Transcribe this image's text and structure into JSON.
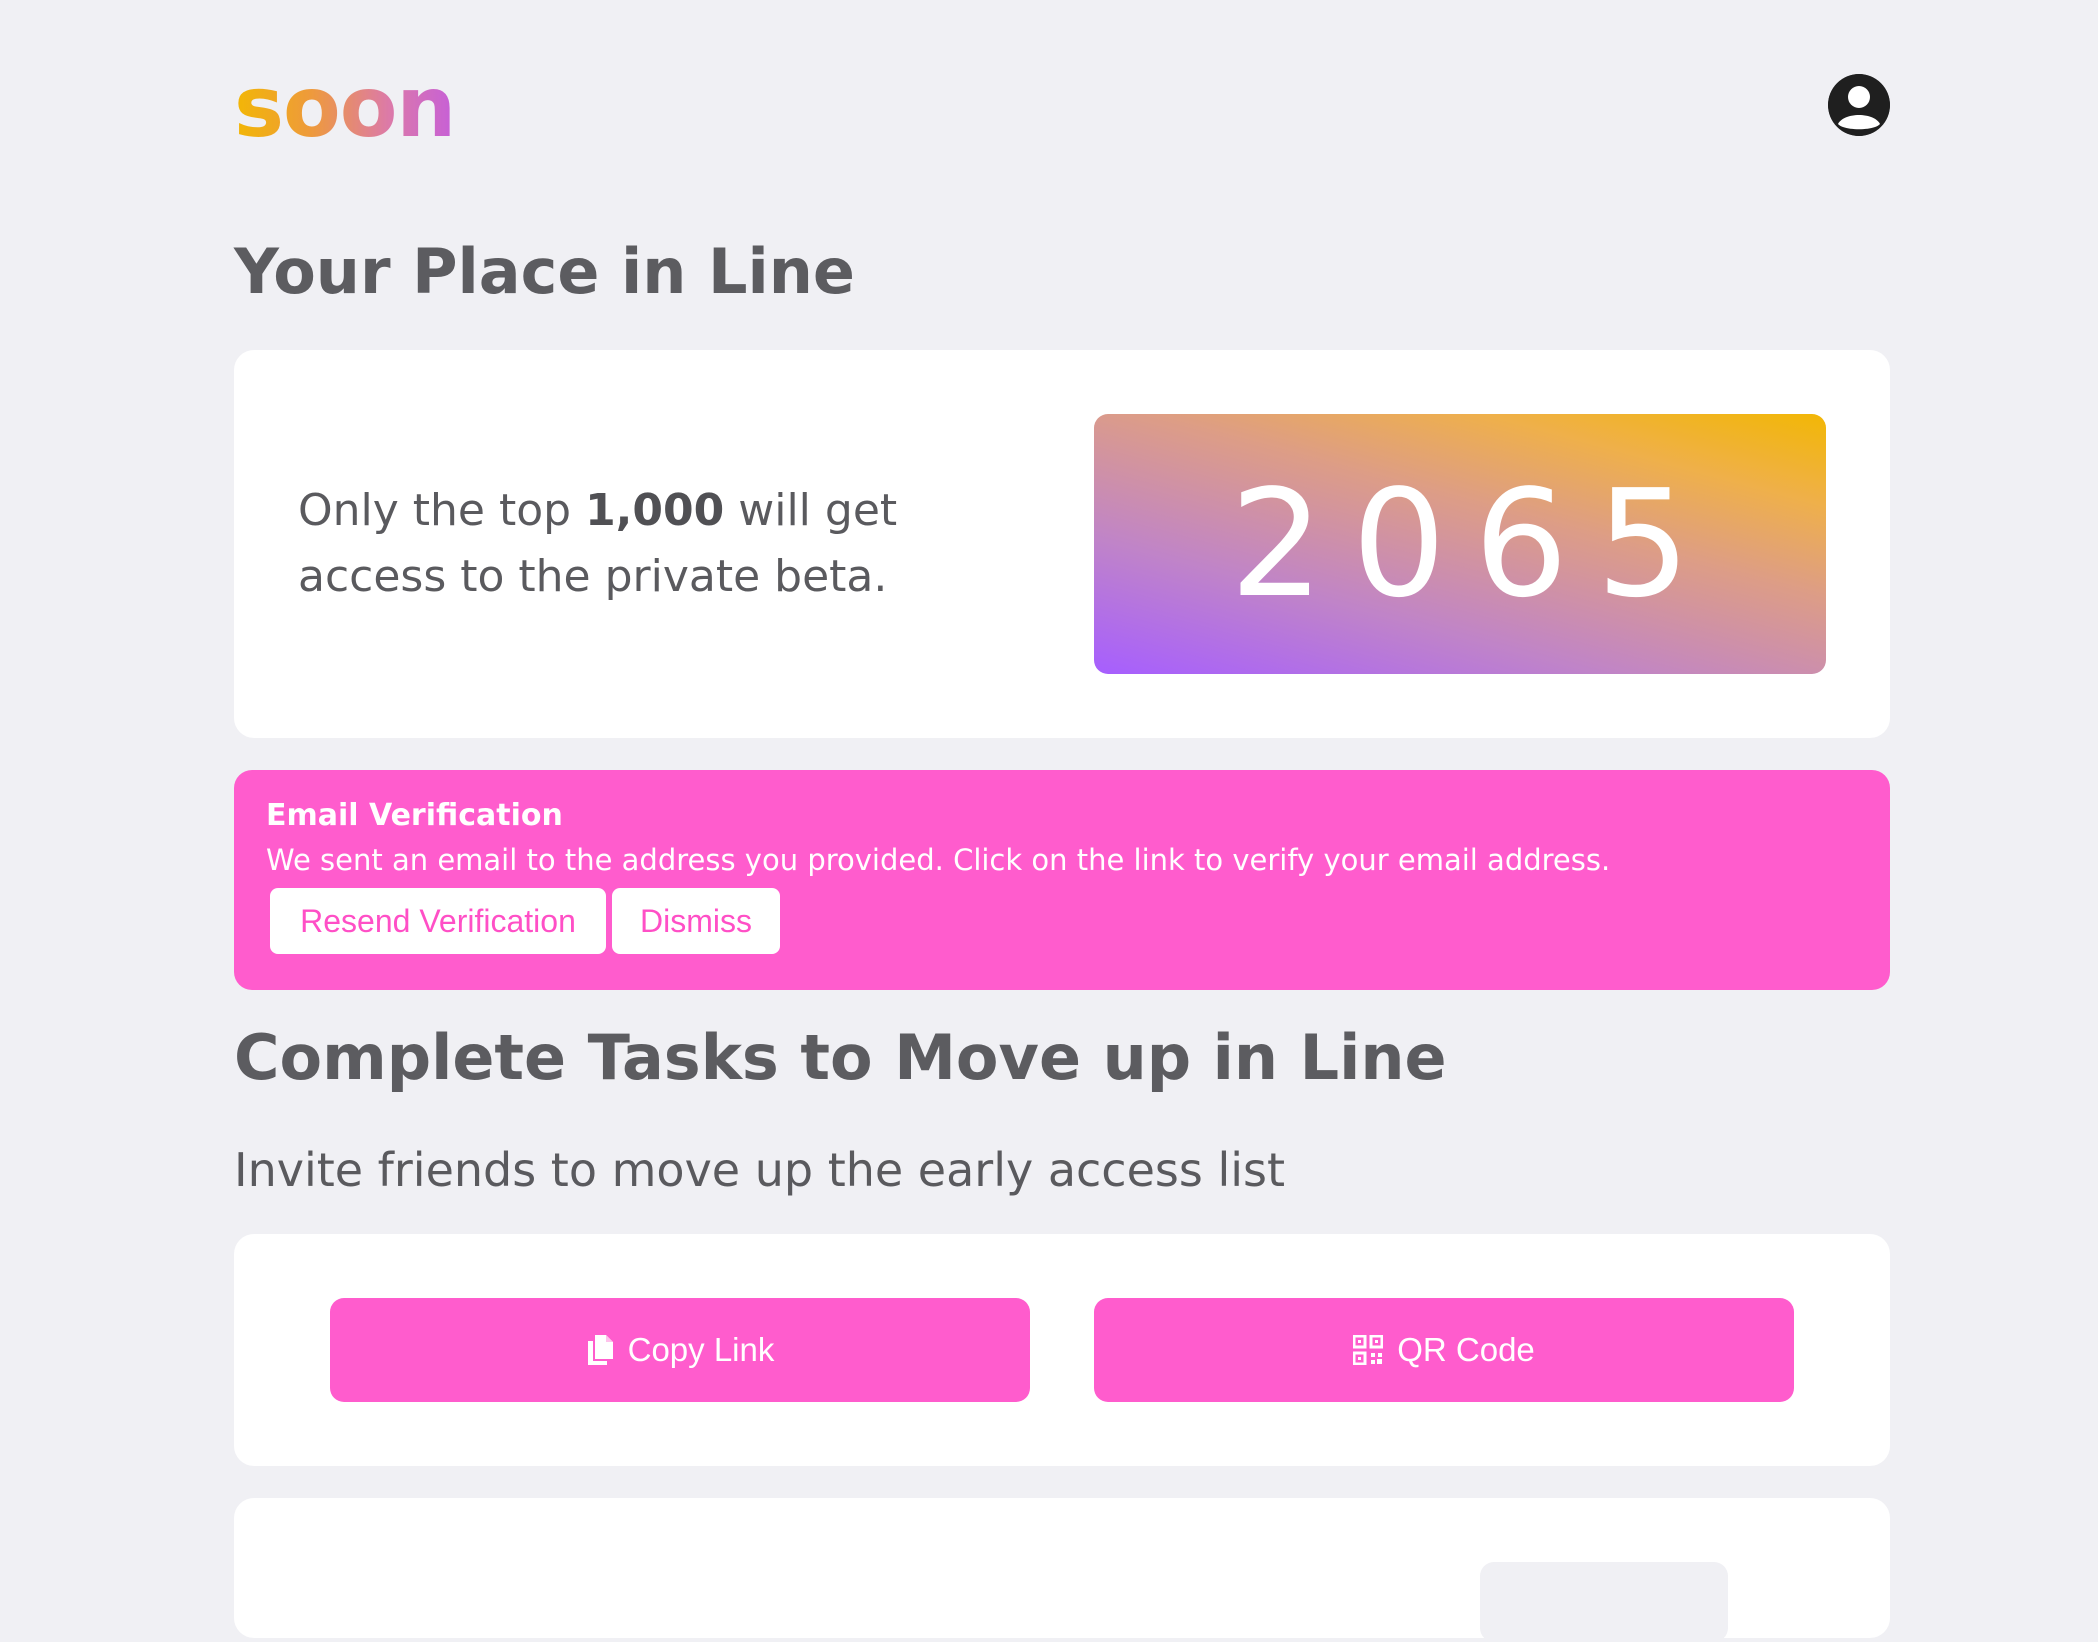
{
  "header": {
    "logo_text": "soon",
    "avatar_icon": "user-circle-icon"
  },
  "place": {
    "title": "Your Place in Line",
    "text_prefix": "Only the top ",
    "text_highlight": "1,000",
    "text_suffix": " will get access to the private beta.",
    "rank": "2065"
  },
  "alert": {
    "title": "Email Verification",
    "message": "We sent an email to the address you provided. Click on the link to verify your email address.",
    "resend_label": "Resend Verification",
    "dismiss_label": "Dismiss",
    "background_color": "#ff5ccd"
  },
  "tasks": {
    "title": "Complete Tasks to Move up in Line",
    "subtitle": "Invite friends to move up the early access list",
    "copy_link_label": "Copy Link",
    "copy_link_icon": "copy-icon",
    "qr_code_label": "QR Code",
    "qr_code_icon": "qr-code-icon"
  },
  "colors": {
    "accent": "#ff5ccd",
    "background": "#f0f0f4",
    "text": "#5a5a5e",
    "logo_gradient_start": "#f2b705",
    "logo_gradient_end": "#c65fd8"
  }
}
